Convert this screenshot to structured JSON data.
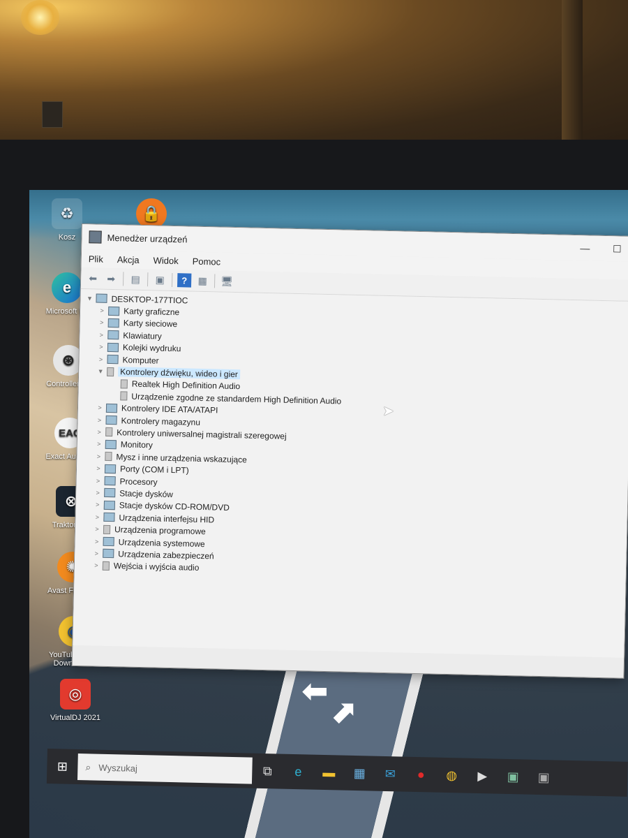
{
  "window": {
    "title": "Menedżer urządzeń",
    "minimize": "—",
    "maximize": "☐"
  },
  "menu": [
    "Plik",
    "Akcja",
    "Widok",
    "Pomoc"
  ],
  "toolbar": {
    "help": "?"
  },
  "tree": {
    "root": "DESKTOP-177TIOC",
    "items": [
      {
        "label": "Karty graficzne",
        "expanded": false
      },
      {
        "label": "Karty sieciowe",
        "expanded": false
      },
      {
        "label": "Klawiatury",
        "expanded": false
      },
      {
        "label": "Kolejki wydruku",
        "expanded": false
      },
      {
        "label": "Komputer",
        "expanded": false
      },
      {
        "label": "Kontrolery dźwięku, wideo i gier",
        "expanded": true,
        "selected": true,
        "children": [
          "Realtek High Definition Audio",
          "Urządzenie zgodne ze standardem High Definition Audio"
        ]
      },
      {
        "label": "Kontrolery IDE ATA/ATAPI",
        "expanded": false
      },
      {
        "label": "Kontrolery magazynu",
        "expanded": false
      },
      {
        "label": "Kontrolery uniwersalnej magistrali szeregowej",
        "expanded": false
      },
      {
        "label": "Monitory",
        "expanded": false
      },
      {
        "label": "Mysz i inne urządzenia wskazujące",
        "expanded": false
      },
      {
        "label": "Porty (COM i LPT)",
        "expanded": false
      },
      {
        "label": "Procesory",
        "expanded": false
      },
      {
        "label": "Stacje dysków",
        "expanded": false
      },
      {
        "label": "Stacje dysków CD-ROM/DVD",
        "expanded": false
      },
      {
        "label": "Urządzenia interfejsu HID",
        "expanded": false
      },
      {
        "label": "Urządzenia programowe",
        "expanded": false
      },
      {
        "label": "Urządzenia systemowe",
        "expanded": false
      },
      {
        "label": "Urządzenia zabezpieczeń",
        "expanded": false
      },
      {
        "label": "Wejścia i wyjścia audio",
        "expanded": false
      }
    ]
  },
  "desktop_icons": [
    {
      "label": "Kosz",
      "icon": "recycle-bin-icon"
    },
    {
      "label": "Microsoft Ec",
      "icon": "edge-icon"
    },
    {
      "label": "Controller Ec",
      "icon": "midi-controller-icon"
    },
    {
      "label": "Exact Audio C",
      "icon": "eac-icon",
      "glyph": "EAC"
    },
    {
      "label": "Traktor Pro",
      "icon": "traktor-icon"
    },
    {
      "label": "Avast Free Ant",
      "icon": "avast-icon"
    },
    {
      "label": "YouTube Song Downloader",
      "icon": "youtube-song-downloader-icon"
    },
    {
      "label": "VirtualDJ 2021",
      "icon": "virtualdj-icon"
    }
  ],
  "taskbar": {
    "search_placeholder": "Wyszukaj",
    "icons": [
      "task-view-icon",
      "edge-icon",
      "file-explorer-icon",
      "store-icon",
      "mail-icon",
      "opera-icon",
      "chrome-icon",
      "media-player-icon",
      "app-icon",
      "app-icon"
    ]
  },
  "colors": {
    "selection": "#cce8ff",
    "help_button": "#2f6fc6",
    "taskbar": "#2a2b2f"
  }
}
